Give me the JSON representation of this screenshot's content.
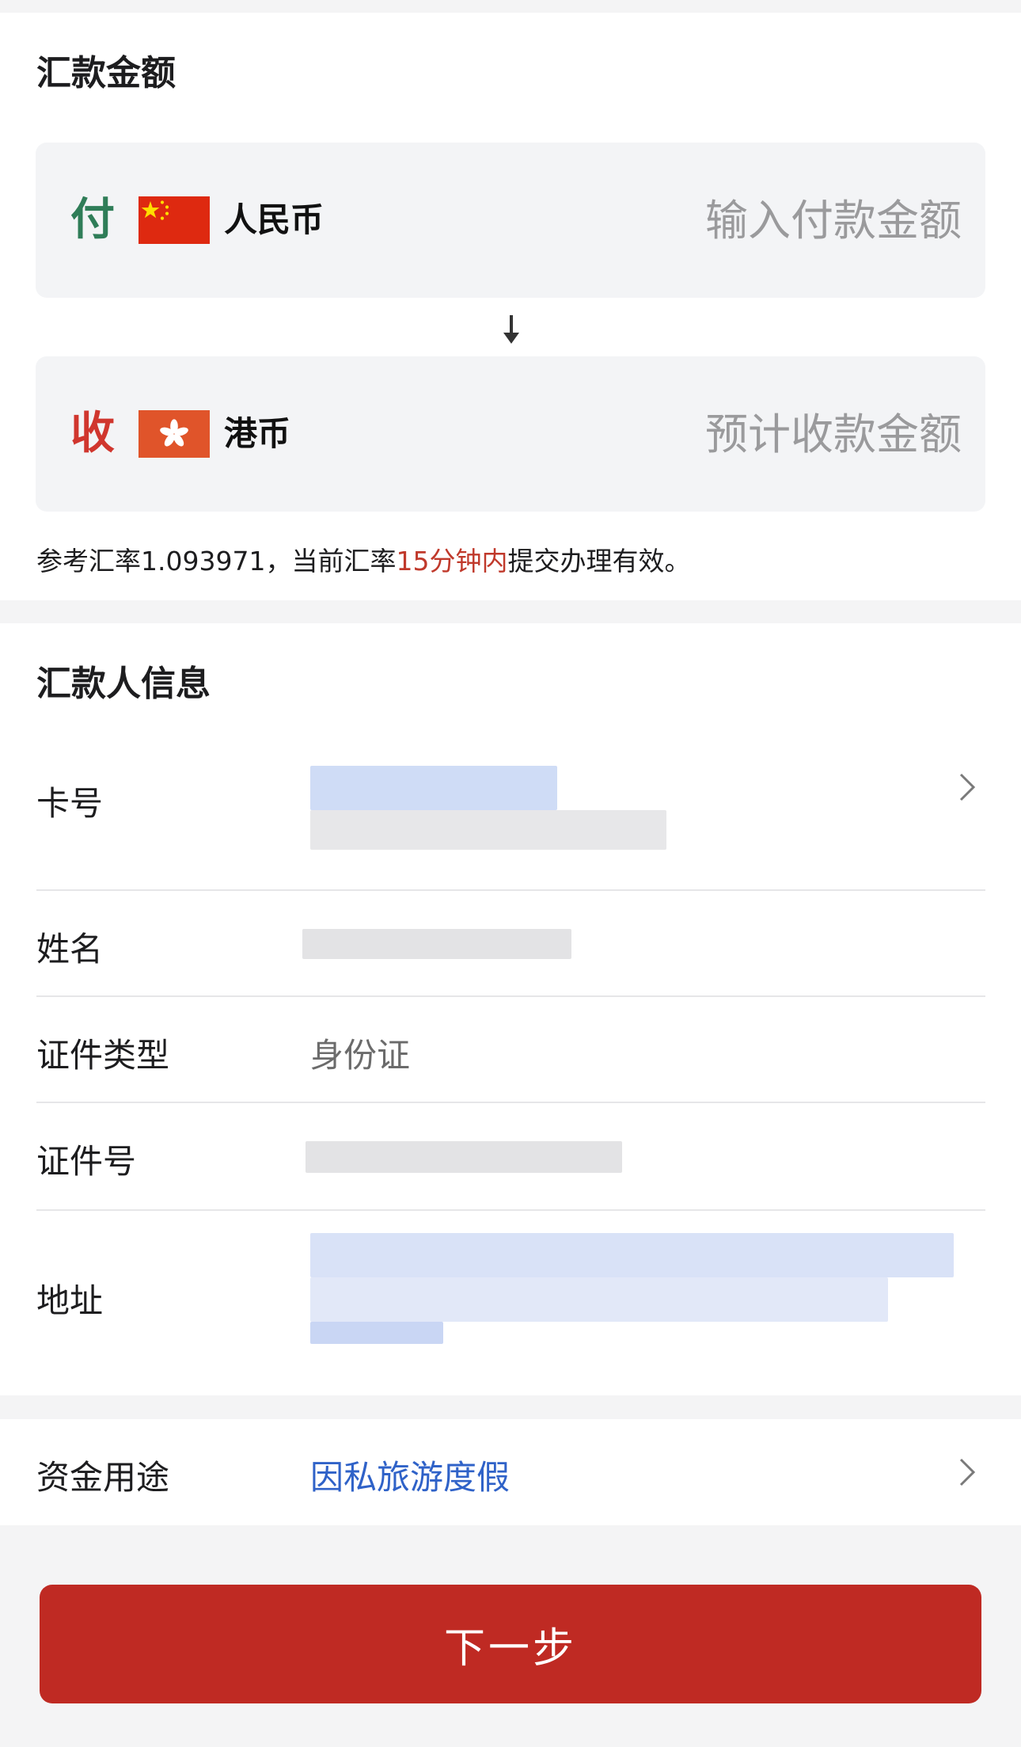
{
  "amount_section": {
    "title": "汇款金额",
    "pay": {
      "direction": "付",
      "currency": "人民币",
      "flag_icon": "cn-flag-icon",
      "placeholder": "输入付款金额"
    },
    "receive": {
      "direction": "收",
      "currency": "港币",
      "flag_icon": "hk-flag-icon",
      "placeholder": "预计收款金额"
    },
    "rate_note": {
      "prefix": "参考汇率1.093971，当前汇率",
      "highlight": "15分钟内",
      "suffix": "提交办理有效。"
    }
  },
  "remitter_section": {
    "title": "汇款人信息",
    "card_label": "卡号",
    "name_label": "姓名",
    "id_type_label": "证件类型",
    "id_type_value": "身份证",
    "id_number_label": "证件号",
    "address_label": "地址"
  },
  "purpose": {
    "label": "资金用途",
    "value": "因私旅游度假"
  },
  "next_button": "下一步",
  "colors": {
    "primary_red": "#bf2a23",
    "pay_green": "#2f7d58",
    "receive_red": "#d0362e",
    "link_blue": "#2f62c8",
    "highlight_red": "#c0392b"
  }
}
